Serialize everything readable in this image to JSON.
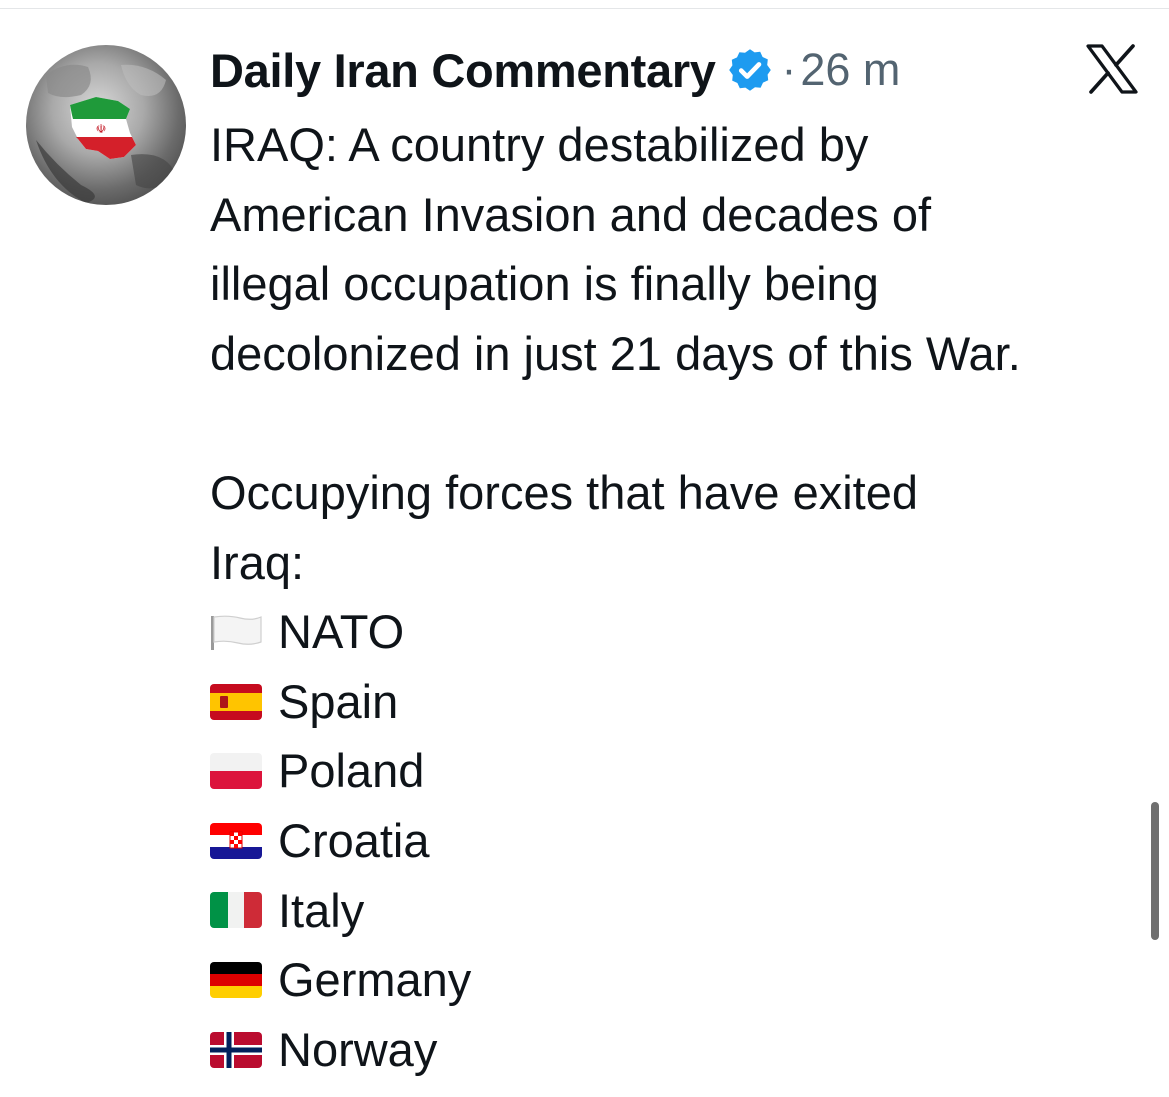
{
  "tweet": {
    "author_name": "Daily Iran Commentary",
    "separator": "·",
    "timestamp": "26 m",
    "intro_lines": [
      "IRAQ: A country destabilized by",
      "American Invasion and decades of",
      "illegal occupation is finally being",
      "decolonized in just 21 days of this War."
    ],
    "list_heading_lines": [
      "Occupying forces that have exited",
      "Iraq:"
    ],
    "forces": [
      {
        "flag_icon": "white-flag-icon",
        "label": "NATO"
      },
      {
        "flag_icon": "spain-flag-icon",
        "label": "Spain"
      },
      {
        "flag_icon": "poland-flag-icon",
        "label": "Poland"
      },
      {
        "flag_icon": "croatia-flag-icon",
        "label": "Croatia"
      },
      {
        "flag_icon": "italy-flag-icon",
        "label": "Italy"
      },
      {
        "flag_icon": "germany-flag-icon",
        "label": "Germany"
      },
      {
        "flag_icon": "norway-flag-icon",
        "label": "Norway"
      }
    ]
  },
  "icons": {
    "avatar": "avatar-map-iran-icon",
    "verified": "verified-badge-icon",
    "close": "x-logo-icon"
  },
  "colors": {
    "text": "#0f1419",
    "secondary_text": "#536471",
    "verified_blue": "#1d9bf0"
  }
}
